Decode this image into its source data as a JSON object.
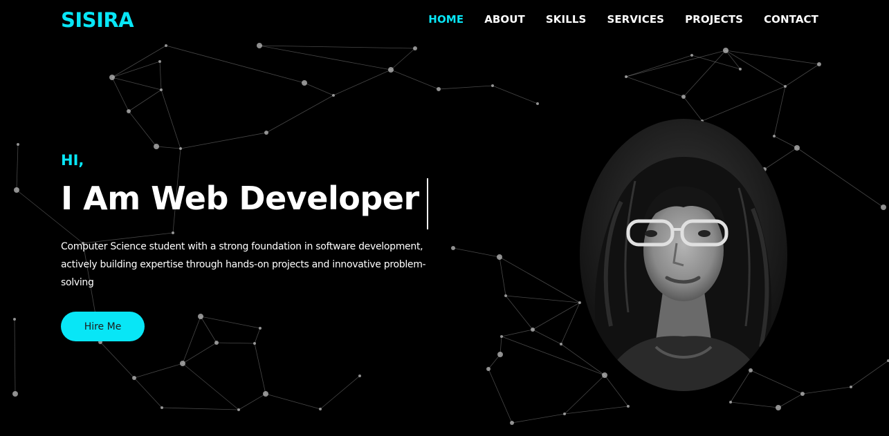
{
  "colors": {
    "accent": "#08e6f6",
    "background": "#000000",
    "text": "#ffffff",
    "network": "#bdbdbd"
  },
  "header": {
    "logo": "SISIRA",
    "nav": [
      {
        "label": "HOME",
        "active": true
      },
      {
        "label": "ABOUT",
        "active": false
      },
      {
        "label": "SKILLS",
        "active": false
      },
      {
        "label": "SERVICES",
        "active": false
      },
      {
        "label": "PROJECTS",
        "active": false
      },
      {
        "label": "CONTACT",
        "active": false
      }
    ]
  },
  "hero": {
    "greeting": "HI,",
    "headline": "I Am Web Developer",
    "description": "Computer Science student with a strong foundation in software development, actively building expertise through hands-on projects and innovative problem-solving",
    "cta_label": "Hire Me"
  },
  "portrait": {
    "icon": "profile-photo"
  }
}
